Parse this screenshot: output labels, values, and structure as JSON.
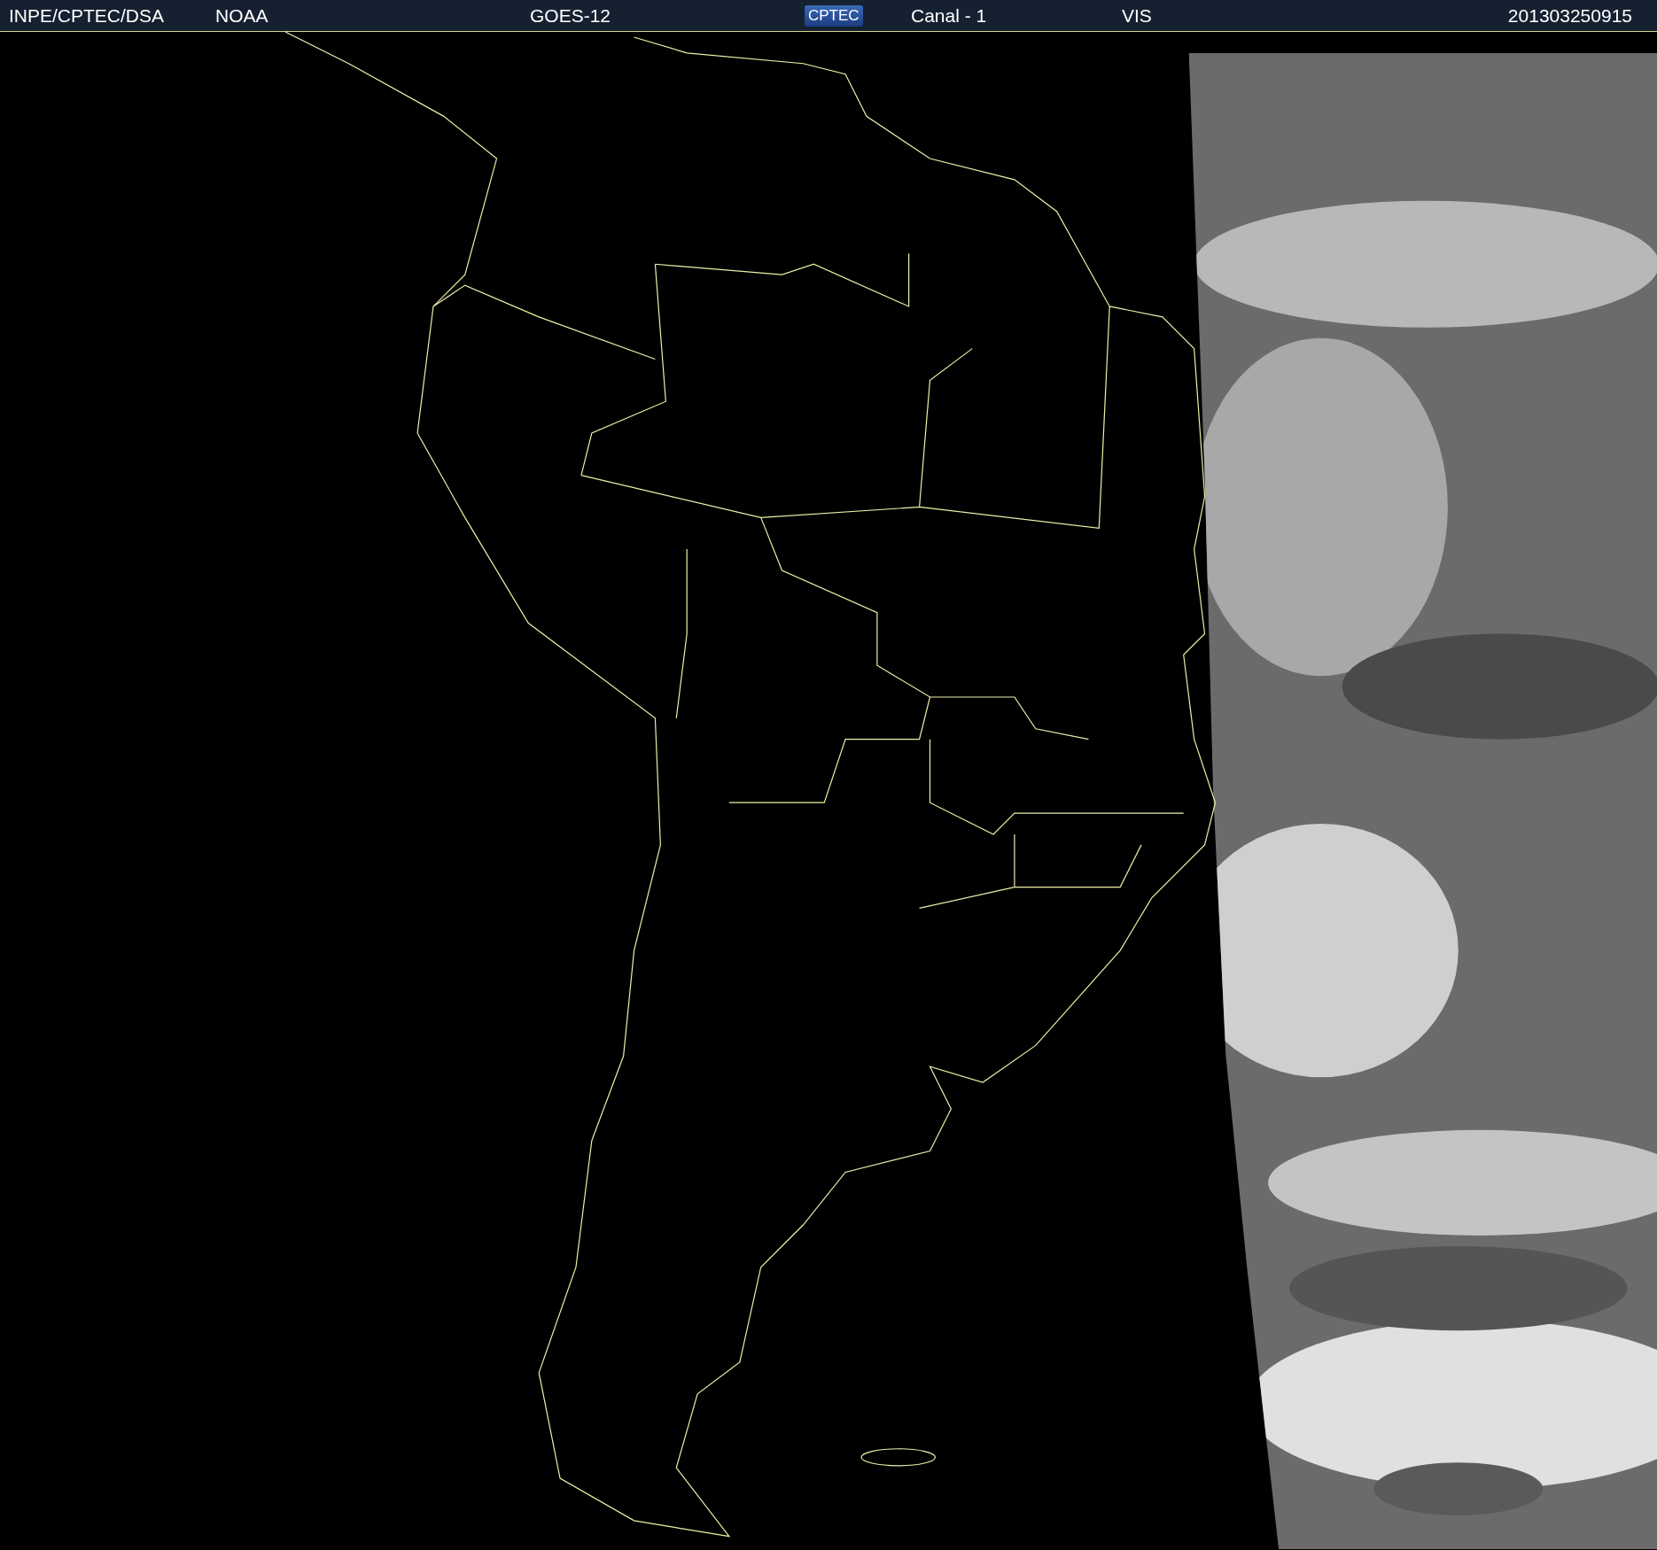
{
  "header": {
    "source": "INPE/CPTEC/DSA",
    "agency": "NOAA",
    "satellite": "GOES-12",
    "logo": "CPTEC",
    "channel": "Canal - 1",
    "band": "VIS",
    "timestamp": "201303250915"
  }
}
